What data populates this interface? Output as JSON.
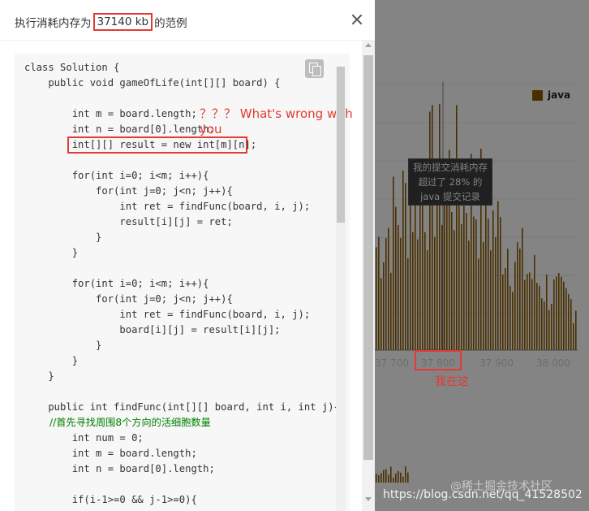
{
  "modal": {
    "title_prefix": "执行消耗内存为",
    "title_highlight": "37140 kb",
    "title_suffix": "的范例",
    "annotation": "？？？ What's wrong with you"
  },
  "code_lines": [
    "class Solution {",
    "    public void gameOfLife(int[][] board) {",
    "",
    "        int m = board.length;",
    "        int n = board[0].length;",
    "        int[][] result = new int[m][n];",
    "",
    "        for(int i=0; i<m; i++){",
    "            for(int j=0; j<n; j++){",
    "                int ret = findFunc(board, i, j);",
    "                result[i][j] = ret;",
    "            }",
    "        }",
    "",
    "        for(int i=0; i<m; i++){",
    "            for(int j=0; j<n; j++){",
    "                int ret = findFunc(board, i, j);",
    "                board[i][j] = result[i][j];",
    "            }",
    "        }",
    "    }",
    "",
    "    public int findFunc(int[][] board, int i, int j){",
    "        //首先寻找周围8个方向的活细胞数量",
    "        int num = 0;",
    "        int m = board.length;",
    "        int n = board[0].length;",
    "",
    "        if(i-1>=0 && j-1>=0){"
  ],
  "chart": {
    "legend": "java",
    "tooltip_lines": [
      "我的提交消耗内存",
      "超过了 28% 的",
      "java 提交记录"
    ],
    "x_ticks": [
      "37 700",
      "37 800",
      "37 900",
      "38 000"
    ],
    "marker_label": "我在这",
    "bar_color": "#8a5a00"
  },
  "watermark": "@稀土掘金技术社区",
  "url": "https://blog.csdn.net/qq_41528502"
}
